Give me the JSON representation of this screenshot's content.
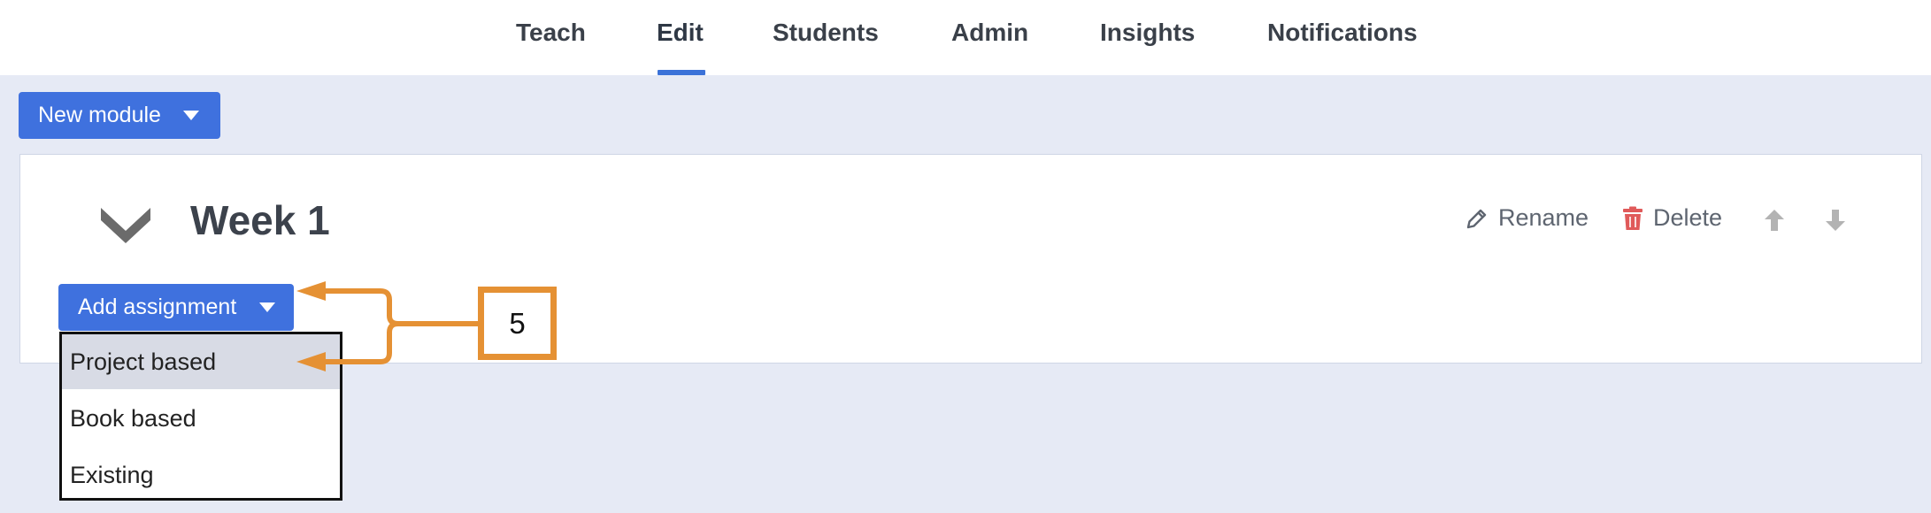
{
  "nav": {
    "tabs": [
      {
        "label": "Teach"
      },
      {
        "label": "Edit",
        "active": true
      },
      {
        "label": "Students"
      },
      {
        "label": "Admin"
      },
      {
        "label": "Insights"
      },
      {
        "label": "Notifications"
      }
    ]
  },
  "toolbar": {
    "new_module_label": "New module"
  },
  "module": {
    "title": "Week 1",
    "actions": {
      "rename": "Rename",
      "delete": "Delete"
    },
    "add_assignment_label": "Add assignment",
    "dropdown": {
      "items": [
        {
          "label": "Project based",
          "highlighted": true
        },
        {
          "label": "Book based"
        },
        {
          "label": "Existing"
        }
      ]
    }
  },
  "annotation": {
    "step_number": "5",
    "color": "#e59134"
  },
  "colors": {
    "accent": "#3f71de",
    "delete_icon": "#e05a5a",
    "background": "#e6eaf5"
  }
}
